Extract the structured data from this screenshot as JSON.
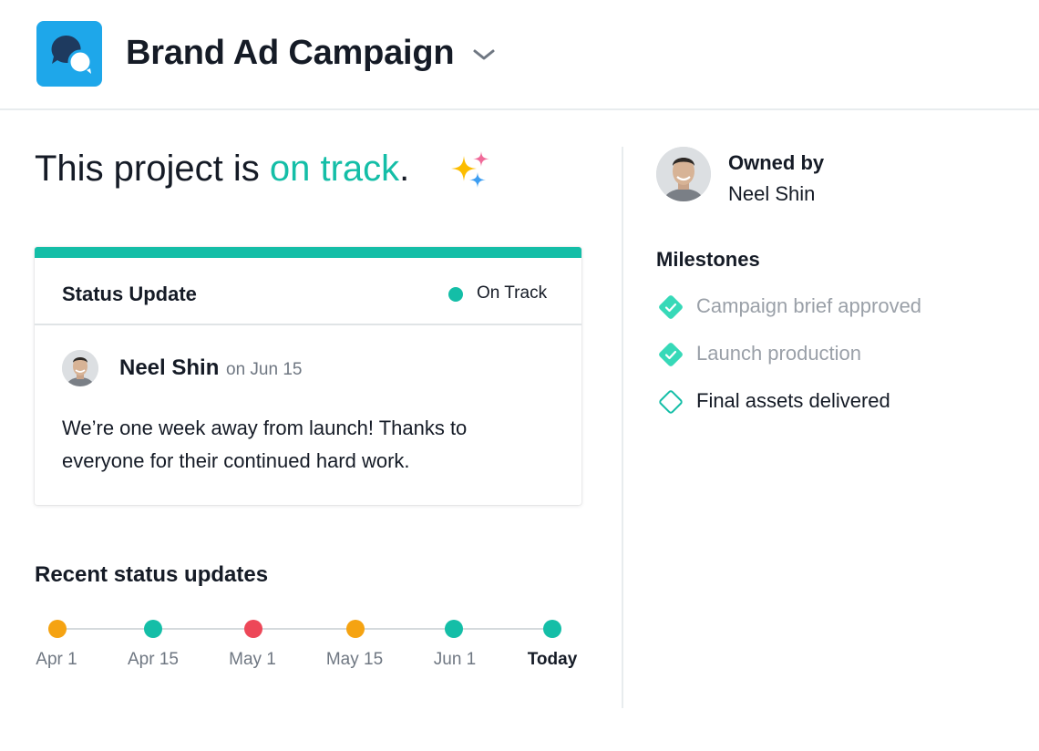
{
  "header": {
    "project_title": "Brand Ad Campaign",
    "app_icon": "chat-bubbles-icon",
    "accent_color": "#1ea7ea"
  },
  "headline": {
    "prefix": "This project is ",
    "status": "on track",
    "suffix": ".",
    "status_color": "#14bea7"
  },
  "status_card": {
    "title": "Status Update",
    "status_label": "On Track",
    "status_color": "#14bea7",
    "author": "Neel Shin",
    "date": "on Jun 15",
    "body": "We’re one week away from launch! Thanks to everyone for their continued hard work."
  },
  "recent": {
    "title": "Recent status updates",
    "points": [
      {
        "label": "Apr 1",
        "color": "#f5a312"
      },
      {
        "label": "Apr 15",
        "color": "#14bea7"
      },
      {
        "label": "May 1",
        "color": "#ed4758"
      },
      {
        "label": "May 15",
        "color": "#f5a312"
      },
      {
        "label": "Jun 1",
        "color": "#14bea7"
      },
      {
        "label": "Today",
        "color": "#14bea7"
      }
    ]
  },
  "owner": {
    "label": "Owned by",
    "name": "Neel Shin"
  },
  "milestones": {
    "title": "Milestones",
    "items": [
      {
        "label": "Campaign brief approved",
        "complete": true
      },
      {
        "label": "Launch production",
        "complete": true
      },
      {
        "label": "Final assets delivered",
        "complete": false
      }
    ]
  }
}
